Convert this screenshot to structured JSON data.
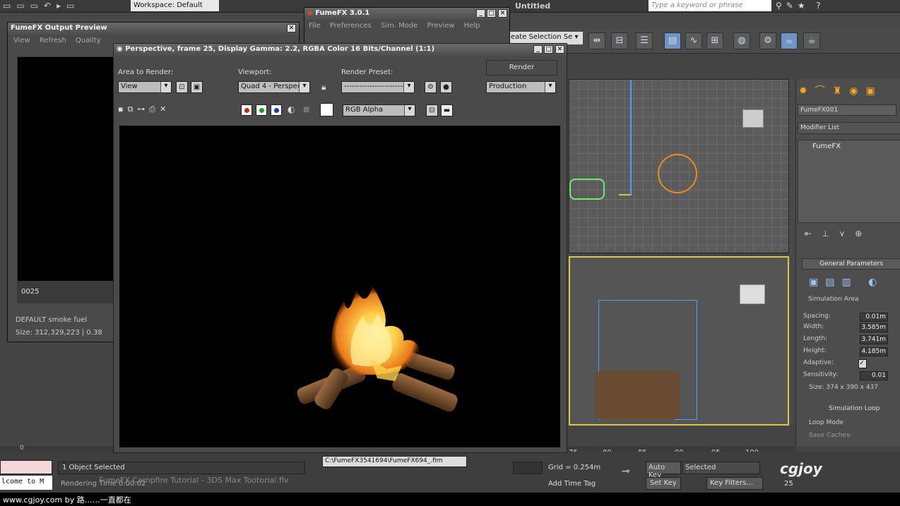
{
  "app": {
    "workspace": "Workspace: Default",
    "title": "Untitled",
    "search_placeholder": "Type a keyword or phrase"
  },
  "fumefx_main": {
    "title": "FumeFX 3.0.1",
    "menu": [
      "File",
      "Preferences",
      "Sim. Mode",
      "Preview",
      "Help"
    ]
  },
  "output_preview": {
    "title": "FumeFX Output Preview",
    "menu": [
      "View",
      "Refresh",
      "Quality"
    ],
    "frame": "0025",
    "info1": "DEFAULT smoke fuel",
    "info2": "Size: 312,329,223 | 0.38"
  },
  "render_window": {
    "title": "Perspective, frame 25, Display Gamma: 2.2, RGBA Color 16 Bits/Channel (1:1)",
    "area_label": "Area to Render:",
    "area_value": "View",
    "viewport_label": "Viewport:",
    "viewport_value": "Quad 4 - Perspec",
    "preset_label": "Render Preset:",
    "preset_value": "-------------------------",
    "render_button": "Render",
    "mode_value": "Production",
    "channel_value": "RGB Alpha"
  },
  "command_panel": {
    "object_name": "FumeFX001",
    "modifier_list": "Modifier List",
    "stack_item": "FumeFX",
    "rollout": "General Parameters",
    "sim_area": "Simulation Area",
    "params": [
      {
        "label": "Spacing:",
        "value": "0.01m"
      },
      {
        "label": "Width:",
        "value": "3.585m"
      },
      {
        "label": "Length:",
        "value": "3.741m"
      },
      {
        "label": "Height:",
        "value": "4.185m"
      },
      {
        "label": "Adaptive:",
        "value": "✓"
      },
      {
        "label": "Sensitivity:",
        "value": "0.01"
      }
    ],
    "size": "Size: 374 x 390 x 437",
    "sim_loop": "Simulation Loop",
    "loop_mode": "Loop Mode",
    "save_caches": "Save Caches:"
  },
  "timeline": {
    "ticks": [
      "75",
      "80",
      "85",
      "90",
      "95",
      "100"
    ],
    "first_tick": "0"
  },
  "status": {
    "selected": "1 Object Selected",
    "rendering_time": "Rendering Time 0:00:02",
    "welcome": "lcome to M",
    "video_title": "FumeFX Campfire Tutorial - 3DS Max Tootorial.flv",
    "path": "C:\\FumeFX3541694\\FumeFX694_.fim",
    "grid": "Grid = 0.254m",
    "auto_key": "Auto Key",
    "set_key": "Set Key",
    "key_selected": "Selected",
    "key_filters": "Key Filters...",
    "add_time_tag": "Add Time Tag",
    "frame_num": "25"
  },
  "footer": {
    "text": "www.cgjoy.com by 路……一直都在",
    "logo": "cgjoy"
  },
  "colors": {
    "fire_core": "#ffe27a",
    "fire_outer": "#f08a1a",
    "log": "#6b4a2e",
    "viewport_border": "#d7c84a"
  }
}
